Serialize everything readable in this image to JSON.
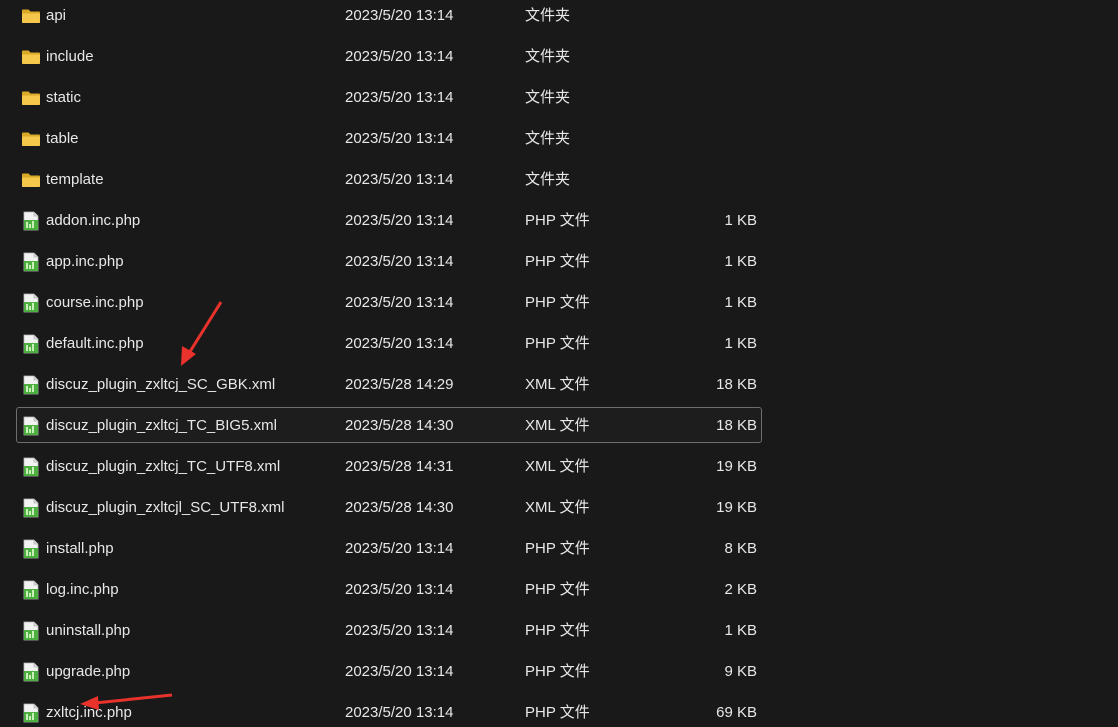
{
  "files": [
    {
      "name": "api",
      "date": "2023/5/20 13:14",
      "type": "文件夹",
      "size": "",
      "icon": "folder-icon"
    },
    {
      "name": "include",
      "date": "2023/5/20 13:14",
      "type": "文件夹",
      "size": "",
      "icon": "folder-icon"
    },
    {
      "name": "static",
      "date": "2023/5/20 13:14",
      "type": "文件夹",
      "size": "",
      "icon": "folder-icon"
    },
    {
      "name": "table",
      "date": "2023/5/20 13:14",
      "type": "文件夹",
      "size": "",
      "icon": "folder-icon"
    },
    {
      "name": "template",
      "date": "2023/5/20 13:14",
      "type": "文件夹",
      "size": "",
      "icon": "folder-icon"
    },
    {
      "name": "addon.inc.php",
      "date": "2023/5/20 13:14",
      "type": "PHP 文件",
      "size": "1 KB",
      "icon": "php-file-icon"
    },
    {
      "name": "app.inc.php",
      "date": "2023/5/20 13:14",
      "type": "PHP 文件",
      "size": "1 KB",
      "icon": "php-file-icon"
    },
    {
      "name": "course.inc.php",
      "date": "2023/5/20 13:14",
      "type": "PHP 文件",
      "size": "1 KB",
      "icon": "php-file-icon"
    },
    {
      "name": "default.inc.php",
      "date": "2023/5/20 13:14",
      "type": "PHP 文件",
      "size": "1 KB",
      "icon": "php-file-icon"
    },
    {
      "name": "discuz_plugin_zxltcj_SC_GBK.xml",
      "date": "2023/5/28 14:29",
      "type": "XML 文件",
      "size": "18 KB",
      "icon": "xml-file-icon"
    },
    {
      "name": "discuz_plugin_zxltcj_TC_BIG5.xml",
      "date": "2023/5/28 14:30",
      "type": "XML 文件",
      "size": "18 KB",
      "icon": "xml-file-icon",
      "selected": true
    },
    {
      "name": "discuz_plugin_zxltcj_TC_UTF8.xml",
      "date": "2023/5/28 14:31",
      "type": "XML 文件",
      "size": "19 KB",
      "icon": "xml-file-icon"
    },
    {
      "name": "discuz_plugin_zxltcjl_SC_UTF8.xml",
      "date": "2023/5/28 14:30",
      "type": "XML 文件",
      "size": "19 KB",
      "icon": "xml-file-icon"
    },
    {
      "name": "install.php",
      "date": "2023/5/20 13:14",
      "type": "PHP 文件",
      "size": "8 KB",
      "icon": "php-file-icon"
    },
    {
      "name": "log.inc.php",
      "date": "2023/5/20 13:14",
      "type": "PHP 文件",
      "size": "2 KB",
      "icon": "php-file-icon"
    },
    {
      "name": "uninstall.php",
      "date": "2023/5/20 13:14",
      "type": "PHP 文件",
      "size": "1 KB",
      "icon": "php-file-icon"
    },
    {
      "name": "upgrade.php",
      "date": "2023/5/20 13:14",
      "type": "PHP 文件",
      "size": "9 KB",
      "icon": "php-file-icon"
    },
    {
      "name": "zxltcj.inc.php",
      "date": "2023/5/20 13:14",
      "type": "PHP 文件",
      "size": "69 KB",
      "icon": "php-file-icon"
    }
  ],
  "colors": {
    "background": "#191919",
    "text": "#e8e8e8",
    "folder": "#f5c84c",
    "arrow": "#e8322b"
  }
}
